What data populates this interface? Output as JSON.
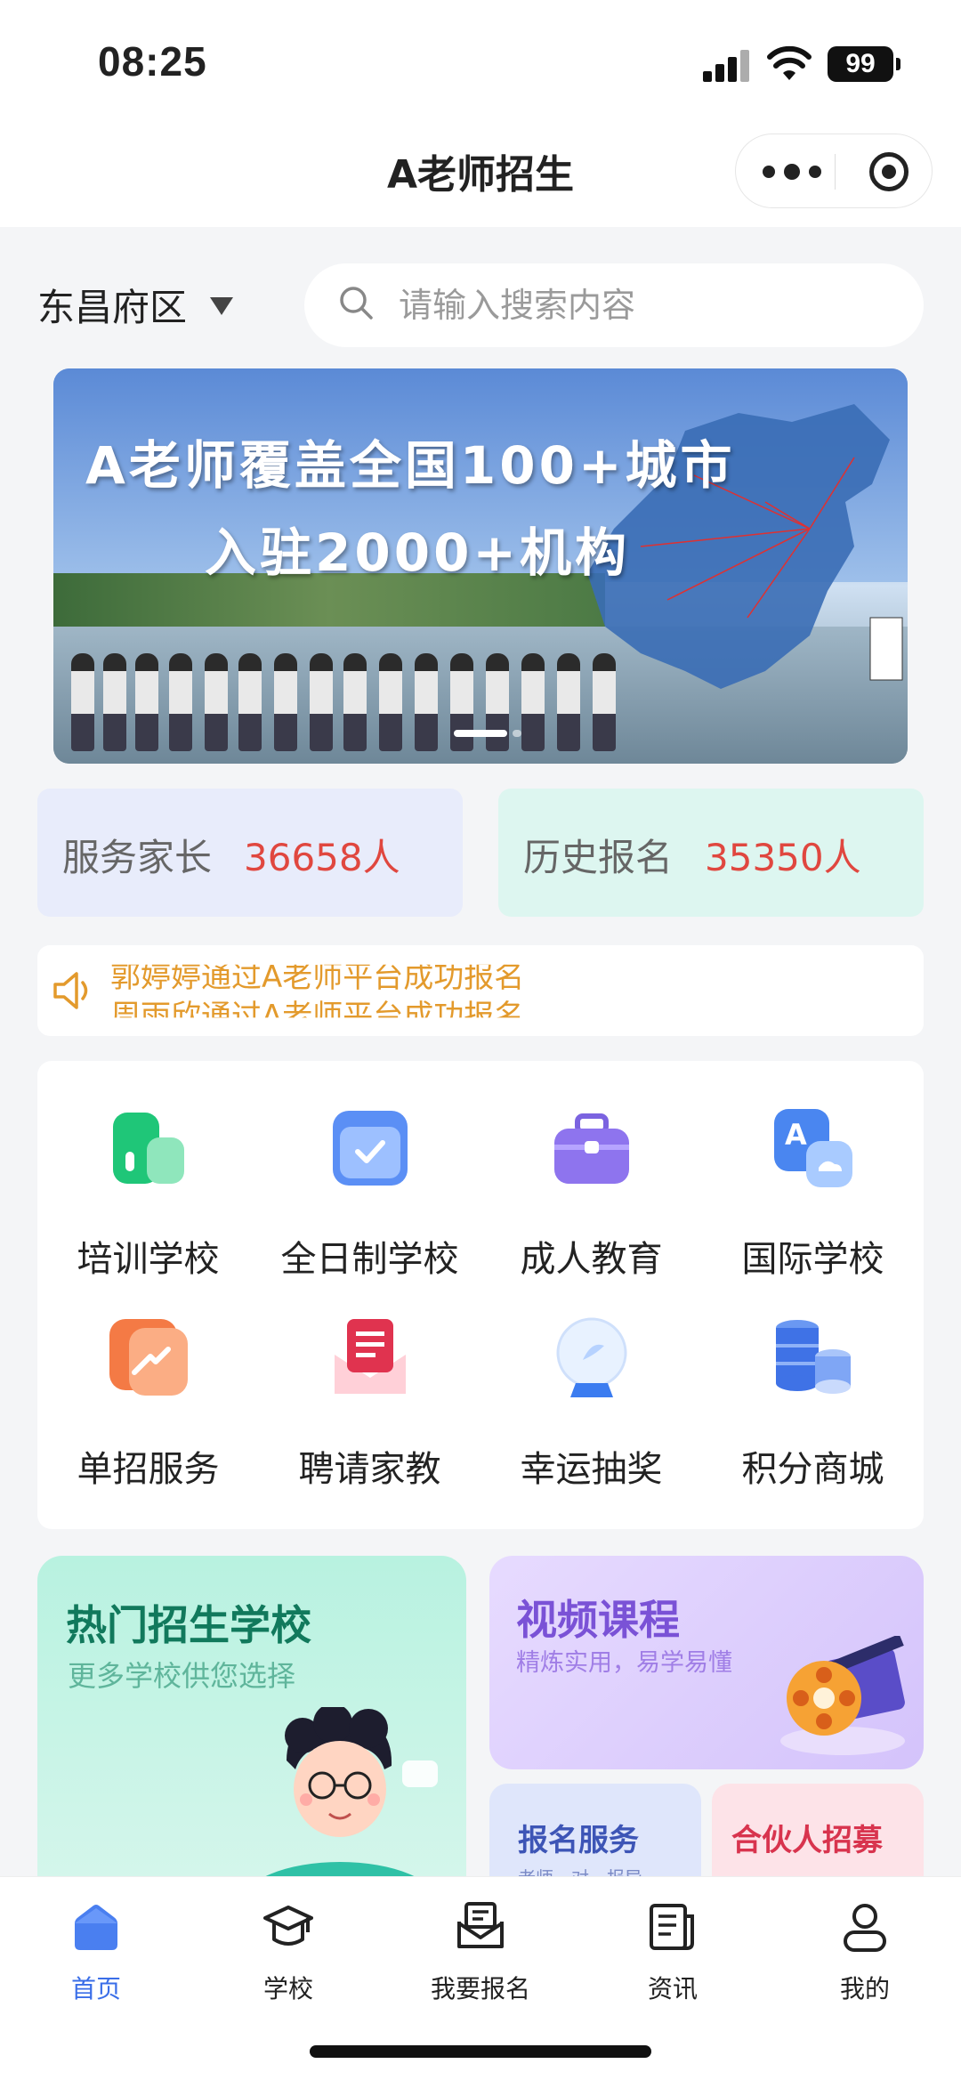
{
  "status_bar": {
    "time": "08:25",
    "battery": "99"
  },
  "nav": {
    "title": "A老师招生"
  },
  "region": {
    "label": "东昌府区"
  },
  "search": {
    "placeholder": "请输入搜索内容"
  },
  "banner": {
    "line1": "A老师覆盖全国100+城市",
    "line2": "入驻2000+机构"
  },
  "stats": [
    {
      "label": "服务家长",
      "value": "36658人"
    },
    {
      "label": "历史报名",
      "value": "35350人"
    }
  ],
  "notice": {
    "line1": "郭婷婷通过A老师平台成功报名",
    "line2": "周雨欣通过A老师平台成功报名"
  },
  "menu": [
    {
      "label": "培训学校",
      "icon": "building-icon"
    },
    {
      "label": "全日制学校",
      "icon": "folder-check-icon"
    },
    {
      "label": "成人教育",
      "icon": "briefcase-icon"
    },
    {
      "label": "国际学校",
      "icon": "translate-icon"
    },
    {
      "label": "单招服务",
      "icon": "trend-icon"
    },
    {
      "label": "聘请家教",
      "icon": "letter-icon"
    },
    {
      "label": "幸运抽奖",
      "icon": "crystal-ball-icon"
    },
    {
      "label": "积分商城",
      "icon": "coins-icon"
    }
  ],
  "promo": {
    "hot": {
      "title": "热门招生学校",
      "subtitle": "更多学校供您选择"
    },
    "video": {
      "title": "视频课程",
      "subtitle": "精炼实用，易学易懂"
    },
    "register": {
      "title": "报名服务",
      "subtitle": "老师一对一报导"
    },
    "partner": {
      "title": "合伙人招募"
    }
  },
  "tabs": [
    {
      "label": "首页",
      "icon": "home-icon",
      "active": true
    },
    {
      "label": "学校",
      "icon": "graduation-cap-icon",
      "active": false
    },
    {
      "label": "我要报名",
      "icon": "envelope-icon",
      "active": false
    },
    {
      "label": "资讯",
      "icon": "news-icon",
      "active": false
    },
    {
      "label": "我的",
      "icon": "user-icon",
      "active": false
    }
  ],
  "colors": {
    "accent": "#3a6ee8",
    "stat_value": "#e0473f",
    "notice": "#e39a2c"
  }
}
